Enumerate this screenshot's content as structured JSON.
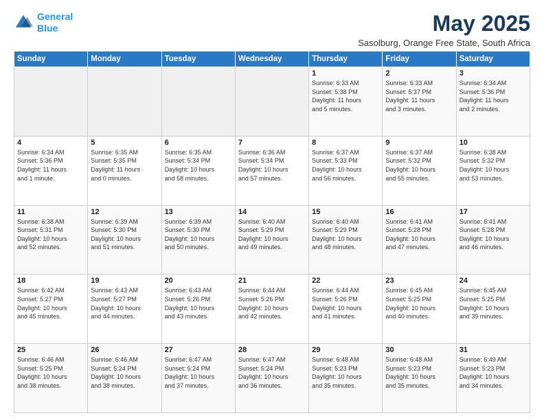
{
  "logo": {
    "line1": "General",
    "line2": "Blue"
  },
  "title": "May 2025",
  "subtitle": "Sasolburg, Orange Free State, South Africa",
  "days_of_week": [
    "Sunday",
    "Monday",
    "Tuesday",
    "Wednesday",
    "Thursday",
    "Friday",
    "Saturday"
  ],
  "weeks": [
    [
      {
        "day": "",
        "info": ""
      },
      {
        "day": "",
        "info": ""
      },
      {
        "day": "",
        "info": ""
      },
      {
        "day": "",
        "info": ""
      },
      {
        "day": "1",
        "info": "Sunrise: 6:33 AM\nSunset: 5:38 PM\nDaylight: 11 hours\nand 5 minutes."
      },
      {
        "day": "2",
        "info": "Sunrise: 6:33 AM\nSunset: 5:37 PM\nDaylight: 11 hours\nand 3 minutes."
      },
      {
        "day": "3",
        "info": "Sunrise: 6:34 AM\nSunset: 5:36 PM\nDaylight: 11 hours\nand 2 minutes."
      }
    ],
    [
      {
        "day": "4",
        "info": "Sunrise: 6:34 AM\nSunset: 5:36 PM\nDaylight: 11 hours\nand 1 minute."
      },
      {
        "day": "5",
        "info": "Sunrise: 6:35 AM\nSunset: 5:35 PM\nDaylight: 11 hours\nand 0 minutes."
      },
      {
        "day": "6",
        "info": "Sunrise: 6:35 AM\nSunset: 5:34 PM\nDaylight: 10 hours\nand 58 minutes."
      },
      {
        "day": "7",
        "info": "Sunrise: 6:36 AM\nSunset: 5:34 PM\nDaylight: 10 hours\nand 57 minutes."
      },
      {
        "day": "8",
        "info": "Sunrise: 6:37 AM\nSunset: 5:33 PM\nDaylight: 10 hours\nand 56 minutes."
      },
      {
        "day": "9",
        "info": "Sunrise: 6:37 AM\nSunset: 5:32 PM\nDaylight: 10 hours\nand 55 minutes."
      },
      {
        "day": "10",
        "info": "Sunrise: 6:38 AM\nSunset: 5:32 PM\nDaylight: 10 hours\nand 53 minutes."
      }
    ],
    [
      {
        "day": "11",
        "info": "Sunrise: 6:38 AM\nSunset: 5:31 PM\nDaylight: 10 hours\nand 52 minutes."
      },
      {
        "day": "12",
        "info": "Sunrise: 6:39 AM\nSunset: 5:30 PM\nDaylight: 10 hours\nand 51 minutes."
      },
      {
        "day": "13",
        "info": "Sunrise: 6:39 AM\nSunset: 5:30 PM\nDaylight: 10 hours\nand 50 minutes."
      },
      {
        "day": "14",
        "info": "Sunrise: 6:40 AM\nSunset: 5:29 PM\nDaylight: 10 hours\nand 49 minutes."
      },
      {
        "day": "15",
        "info": "Sunrise: 6:40 AM\nSunset: 5:29 PM\nDaylight: 10 hours\nand 48 minutes."
      },
      {
        "day": "16",
        "info": "Sunrise: 6:41 AM\nSunset: 5:28 PM\nDaylight: 10 hours\nand 47 minutes."
      },
      {
        "day": "17",
        "info": "Sunrise: 6:41 AM\nSunset: 5:28 PM\nDaylight: 10 hours\nand 46 minutes."
      }
    ],
    [
      {
        "day": "18",
        "info": "Sunrise: 6:42 AM\nSunset: 5:27 PM\nDaylight: 10 hours\nand 45 minutes."
      },
      {
        "day": "19",
        "info": "Sunrise: 6:43 AM\nSunset: 5:27 PM\nDaylight: 10 hours\nand 44 minutes."
      },
      {
        "day": "20",
        "info": "Sunrise: 6:43 AM\nSunset: 5:26 PM\nDaylight: 10 hours\nand 43 minutes."
      },
      {
        "day": "21",
        "info": "Sunrise: 6:44 AM\nSunset: 5:26 PM\nDaylight: 10 hours\nand 42 minutes."
      },
      {
        "day": "22",
        "info": "Sunrise: 6:44 AM\nSunset: 5:26 PM\nDaylight: 10 hours\nand 41 minutes."
      },
      {
        "day": "23",
        "info": "Sunrise: 6:45 AM\nSunset: 5:25 PM\nDaylight: 10 hours\nand 40 minutes."
      },
      {
        "day": "24",
        "info": "Sunrise: 6:45 AM\nSunset: 5:25 PM\nDaylight: 10 hours\nand 39 minutes."
      }
    ],
    [
      {
        "day": "25",
        "info": "Sunrise: 6:46 AM\nSunset: 5:25 PM\nDaylight: 10 hours\nand 38 minutes."
      },
      {
        "day": "26",
        "info": "Sunrise: 6:46 AM\nSunset: 5:24 PM\nDaylight: 10 hours\nand 38 minutes."
      },
      {
        "day": "27",
        "info": "Sunrise: 6:47 AM\nSunset: 5:24 PM\nDaylight: 10 hours\nand 37 minutes."
      },
      {
        "day": "28",
        "info": "Sunrise: 6:47 AM\nSunset: 5:24 PM\nDaylight: 10 hours\nand 36 minutes."
      },
      {
        "day": "29",
        "info": "Sunrise: 6:48 AM\nSunset: 5:23 PM\nDaylight: 10 hours\nand 35 minutes."
      },
      {
        "day": "30",
        "info": "Sunrise: 6:48 AM\nSunset: 5:23 PM\nDaylight: 10 hours\nand 35 minutes."
      },
      {
        "day": "31",
        "info": "Sunrise: 6:49 AM\nSunset: 5:23 PM\nDaylight: 10 hours\nand 34 minutes."
      }
    ]
  ]
}
